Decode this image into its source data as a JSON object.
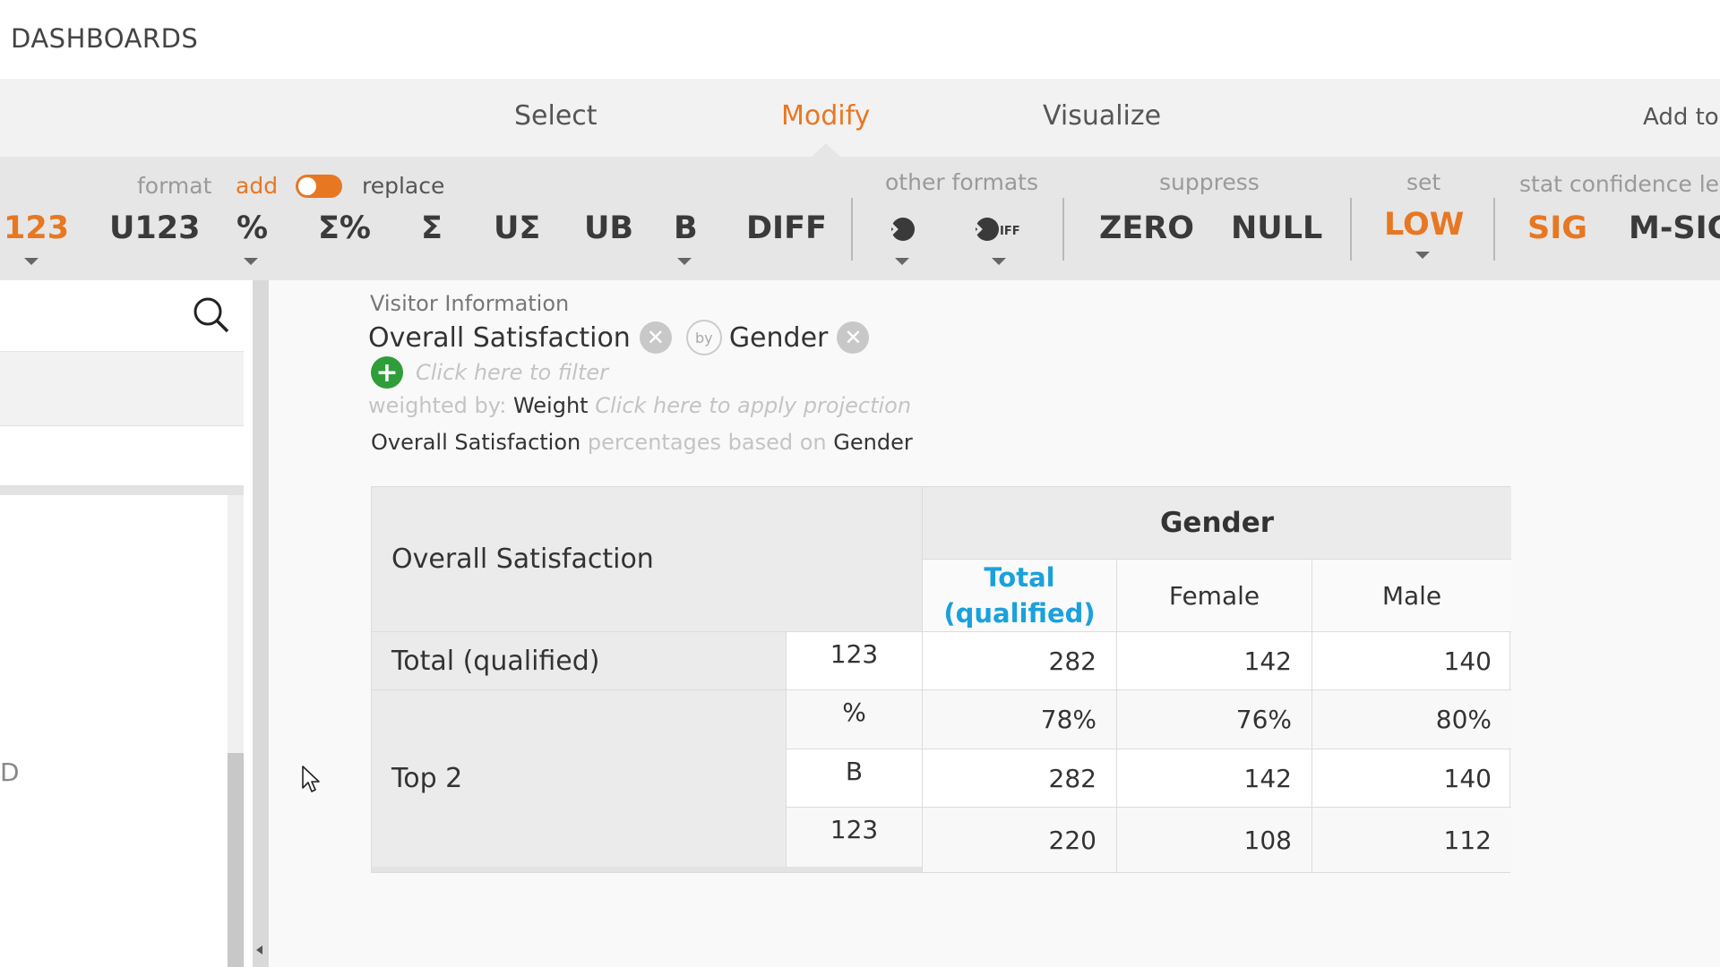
{
  "app": {
    "title": "DASHBOARDS"
  },
  "tabs": [
    {
      "label": "Select"
    },
    {
      "label": "Modify",
      "active": true
    },
    {
      "label": "Visualize"
    },
    {
      "label": "Add to"
    }
  ],
  "toolbar": {
    "format_label": "format",
    "add_label": "add",
    "replace_label": "replace",
    "toggle_state": "add",
    "other_formats_label": "other formats",
    "suppress_label": "suppress",
    "set_label": "set",
    "stat_label": "stat confidence le",
    "buttons": {
      "n123": "123",
      "u123": "U123",
      "pct": "%",
      "sigma_pct": "Σ%",
      "sigma": "Σ",
      "u_sigma": "UΣ",
      "ub": "UB",
      "b": "B",
      "diff": "DIFF",
      "zero": "ZERO",
      "null": "NULL",
      "low": "LOW",
      "sig": "SIG",
      "msig": "M-SIG"
    },
    "icons": {
      "other_format_1": "mean-icon",
      "other_format_2": "mean-diff-icon"
    },
    "colors": {
      "accent": "#e87722",
      "toolbar_bg": "#e6e6e6"
    }
  },
  "left_panel": {
    "partial_text": "D"
  },
  "query": {
    "dataset": "Visitor Information",
    "row_variable": "Overall Satisfaction",
    "by_label": "by",
    "column_variable": "Gender",
    "filter_placeholder": "Click here to filter",
    "weighted_by_label": "weighted by:",
    "weight_variable": "Weight",
    "projection_placeholder": "Click here to apply projection",
    "base_row_var": "Overall Satisfaction",
    "base_text": "percentages based on",
    "base_col_var": "Gender"
  },
  "table": {
    "row_header": "Overall Satisfaction",
    "group_header": "Gender",
    "columns": [
      "Total (qualified)",
      "Female",
      "Male"
    ],
    "rows": [
      {
        "label": "Total (qualified)",
        "stat": "123",
        "values": [
          "282",
          "142",
          "140"
        ]
      },
      {
        "label": "Top 2",
        "stat": "%",
        "values": [
          "78%",
          "76%",
          "80%"
        ]
      },
      {
        "label": "",
        "stat": "B",
        "values": [
          "282",
          "142",
          "140"
        ]
      },
      {
        "label": "",
        "stat": "123",
        "values": [
          "220",
          "108",
          "112"
        ]
      }
    ],
    "colors": {
      "total_header": "#1aa1dc"
    }
  }
}
